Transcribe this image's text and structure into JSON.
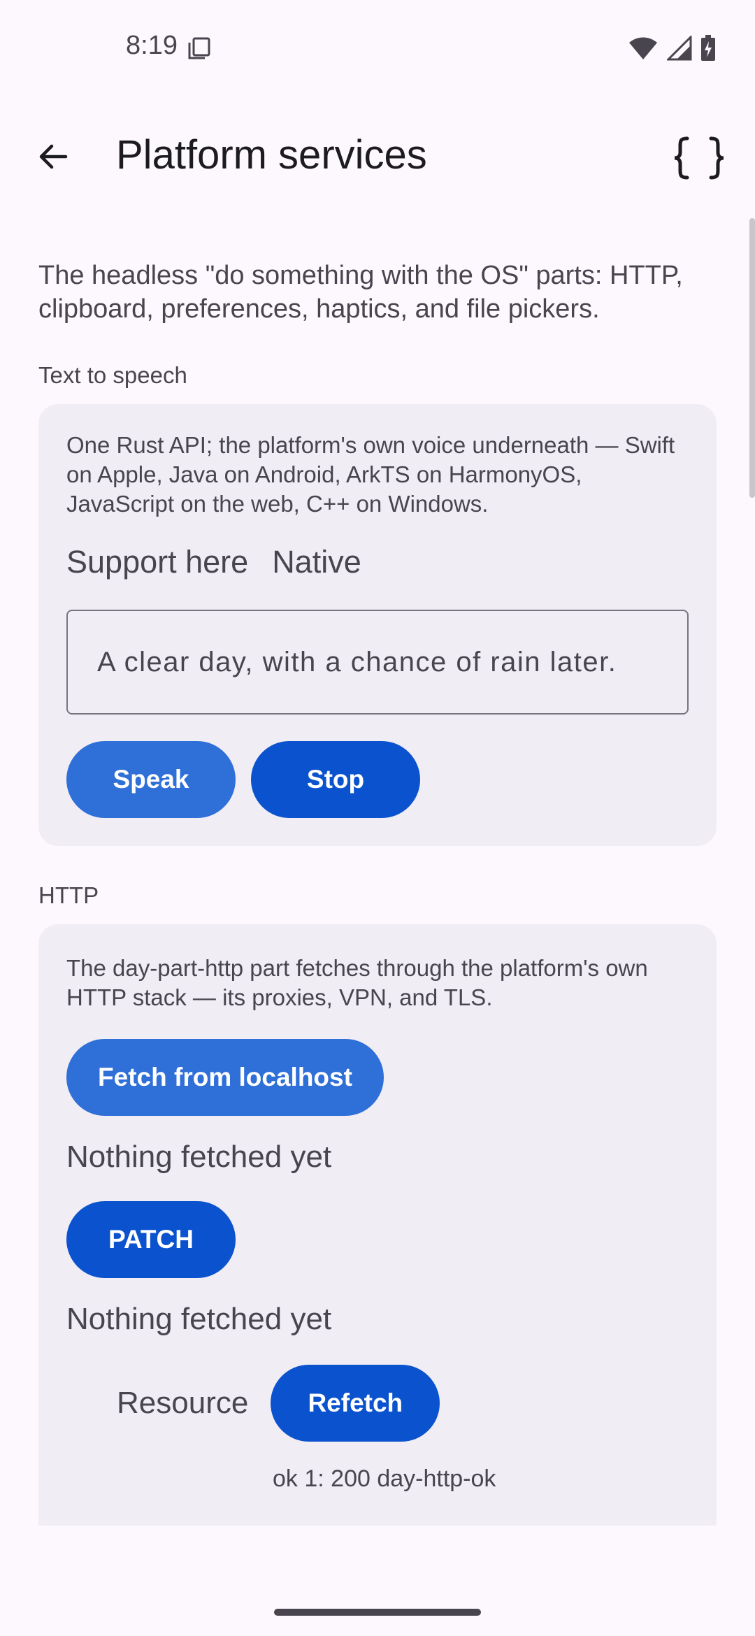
{
  "status_bar": {
    "time": "8:19",
    "icons": [
      "screenshot-icon",
      "wifi-icon",
      "signal-icon",
      "battery-charging-icon"
    ]
  },
  "app_bar": {
    "title": "Platform services",
    "back_icon": "arrow-left-icon",
    "action_icon": "braces-icon"
  },
  "intro": "The headless \"do something with the OS\" parts: HTTP, clipboard, preferences, haptics, and file pickers.",
  "tts": {
    "section_label": "Text to speech",
    "description": "One Rust API; the platform's own voice underneath — Swift on Apple, Java on Android, ArkTS on HarmonyOS, JavaScript on the web, C++ on Windows.",
    "support_label": "Support here",
    "support_value": "Native",
    "input_value": "A clear day, with a chance of rain later.",
    "speak_label": "Speak",
    "stop_label": "Stop"
  },
  "http": {
    "section_label": "HTTP",
    "description": "The day-part-http part fetches through the platform's own HTTP stack — its proxies, VPN, and TLS.",
    "fetch_label": "Fetch from localhost",
    "fetch_result": "Nothing fetched yet",
    "patch_label": "PATCH",
    "patch_result": "Nothing fetched yet",
    "resource_label": "Resource",
    "refetch_label": "Refetch",
    "ok_line": "ok 1: 200 day-http-ok"
  },
  "colors": {
    "background": "#fdf8fd",
    "card": "#f1edf5",
    "primary_light": "#2f6fd8",
    "primary_dark": "#0b53ce",
    "text": "#1c1b1f",
    "text_secondary": "#49454f"
  }
}
